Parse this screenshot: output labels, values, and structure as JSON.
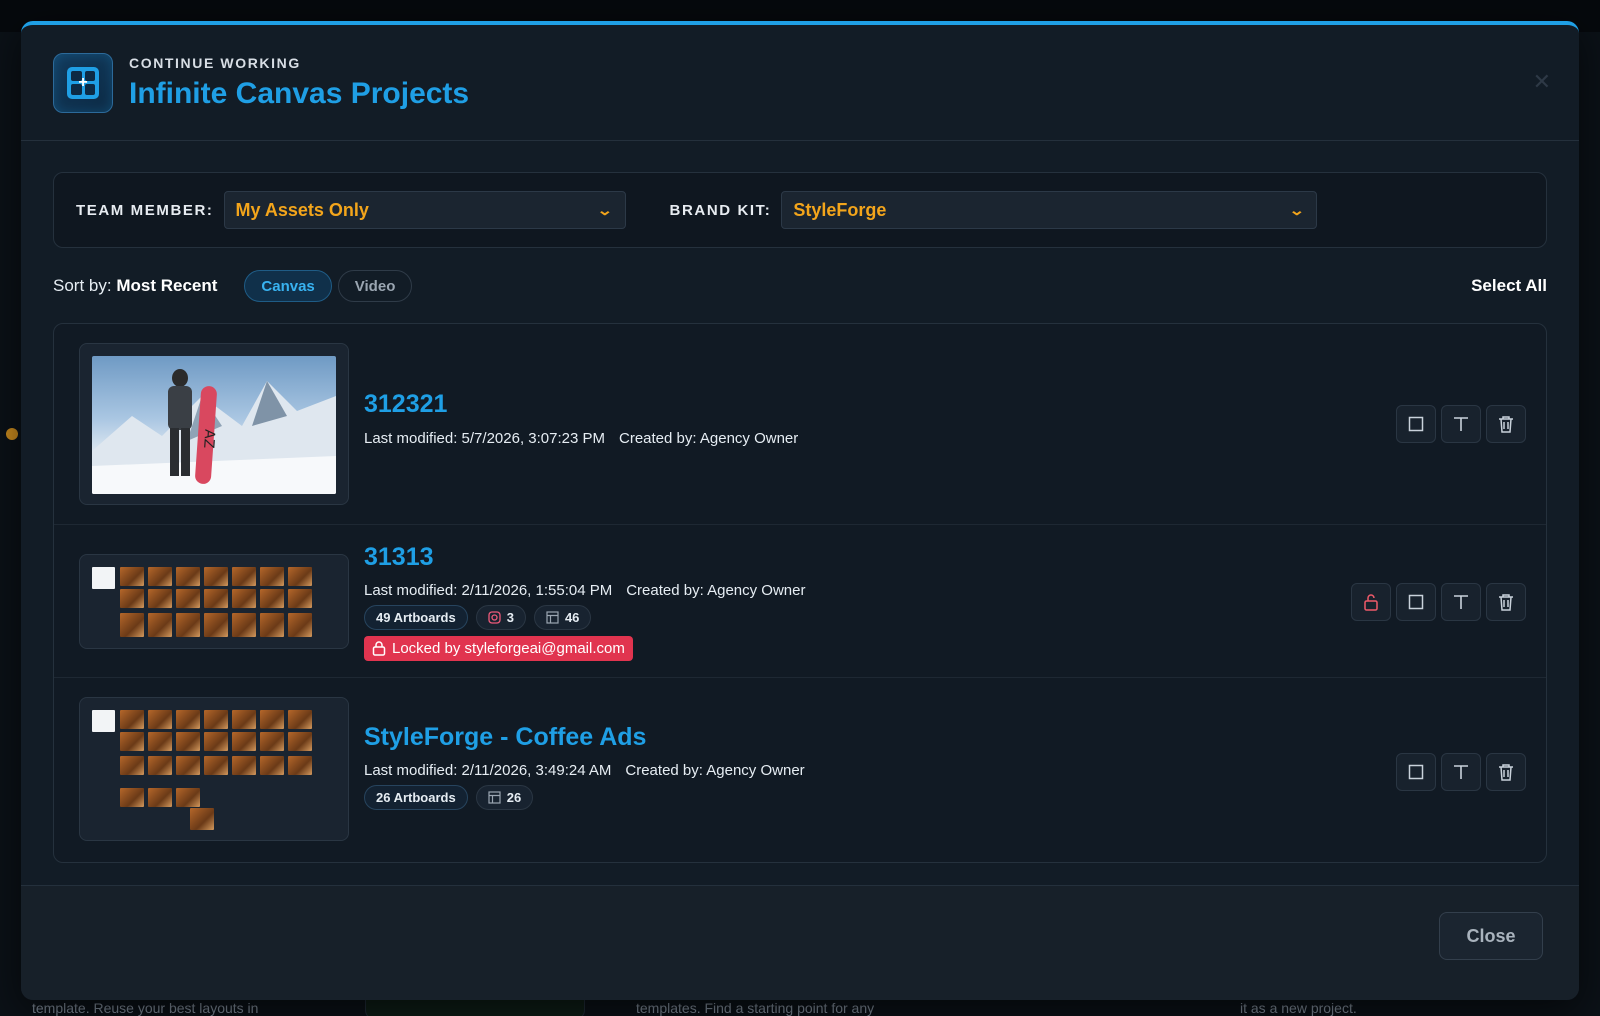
{
  "background": {
    "footer_texts": [
      "template. Reuse your best layouts in",
      "templates. Find a starting point for any",
      "it as a new project."
    ]
  },
  "header": {
    "eyebrow": "CONTINUE WORKING",
    "title": "Infinite Canvas Projects",
    "close_icon": "close-icon"
  },
  "filters": {
    "team_label": "TEAM MEMBER:",
    "team_value": "My Assets Only",
    "brand_label": "BRAND KIT:",
    "brand_value": "StyleForge"
  },
  "sort": {
    "prefix": "Sort by:",
    "value": "Most Recent",
    "tabs": [
      {
        "label": "Canvas",
        "active": true
      },
      {
        "label": "Video",
        "active": false
      }
    ],
    "select_all": "Select All"
  },
  "projects": [
    {
      "title": "312321",
      "modified": "Last modified: 5/7/2026, 3:07:23 PM",
      "created": "Created by: Agency Owner",
      "thumb_caption": "Snowboarder on mountain summit",
      "actions": [
        "select-icon",
        "text-icon",
        "trash-icon"
      ]
    },
    {
      "title": "31313",
      "modified": "Last modified: 2/11/2026, 1:55:04 PM",
      "created": "Created by: Agency Owner",
      "chips": {
        "artboards": "49 Artboards",
        "instagram": "3",
        "layouts": "46"
      },
      "locked": "Locked by styleforgeai@gmail.com",
      "actions": [
        "unlock-icon",
        "select-icon",
        "text-icon",
        "trash-icon"
      ]
    },
    {
      "title": "StyleForge - Coffee Ads",
      "modified": "Last modified: 2/11/2026, 3:49:24 AM",
      "created": "Created by: Agency Owner",
      "chips": {
        "artboards": "26 Artboards",
        "layouts": "26"
      },
      "actions": [
        "select-icon",
        "text-icon",
        "trash-icon"
      ]
    }
  ],
  "footer": {
    "close_label": "Close"
  },
  "colors": {
    "accent": "#1f9fe5",
    "select_value": "#f3a51b",
    "lock_red": "#e1344f"
  }
}
